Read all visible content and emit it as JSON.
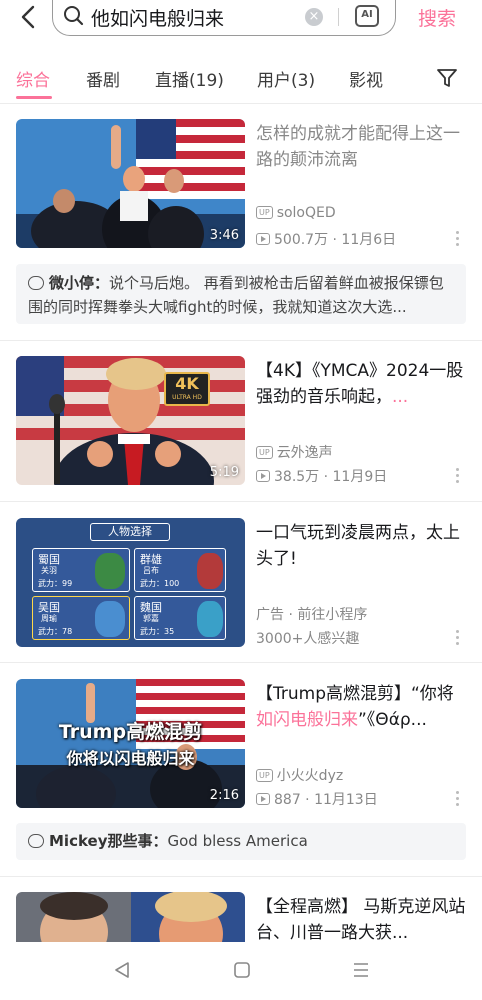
{
  "search": {
    "query": "他如闪电般归来",
    "button": "搜索",
    "clear_icon": "close-circle-icon",
    "ai_label": "AI"
  },
  "tabs": [
    {
      "label": "综合"
    },
    {
      "label": "番剧"
    },
    {
      "label": "直播(19)"
    },
    {
      "label": "用户(3)"
    },
    {
      "label": "影视"
    }
  ],
  "results": [
    {
      "title": "怎样的成就才能配得上这一路的颠沛流离",
      "uploader": "soloQED",
      "stats": "500.7万 · 11月6日",
      "duration": "3:46"
    },
    {
      "title_before": "【4K】《YMCA》2024一股强劲的音乐响起，",
      "title_ellipsis": "...",
      "uploader": "云外逸声",
      "stats": "38.5万 · 11月9日",
      "duration": "5:19",
      "badge": "4K",
      "badge_sub": "ULTRA HD"
    },
    {
      "title": "一口气玩到凌晨两点，太上头了!",
      "ad_label": "广告 · 前往小程序",
      "interest": "3000+人感兴趣",
      "game": {
        "header": "人物选择",
        "cells": [
          {
            "kingdom": "蜀国",
            "name": "关羽",
            "power": "武力：99"
          },
          {
            "kingdom": "群雄",
            "name": "吕布",
            "power": "武力：100"
          },
          {
            "kingdom": "吴国",
            "name": "周瑜",
            "power": "武力：78"
          },
          {
            "kingdom": "魏国",
            "name": "郭嘉",
            "power": "武力：35"
          }
        ]
      }
    },
    {
      "title_before": "【Trump高燃混剪】“你将",
      "title_highlight": "如闪电般归来",
      "title_after": "”《Θάρ...",
      "uploader": "小火火dyz",
      "stats": "887 · 11月13日",
      "duration": "2:16",
      "overlay_line1": "Trump高燃混剪",
      "overlay_line2": "你将以闪电般归来"
    },
    {
      "title": "【全程高燃】 马斯克逆风站台、川普一路大获..."
    }
  ],
  "comments": [
    {
      "user": "微小停：",
      "text": "说个马后炮。 再看到被枪击后留着鲜血被报保镖包围的同时挥舞拳头大喊fight的时候，我就知道这次大选..."
    },
    {
      "user": "Mickey那些事：",
      "text": "God bless America"
    }
  ],
  "colors": {
    "accent": "#fb7299",
    "muted": "#888888"
  }
}
